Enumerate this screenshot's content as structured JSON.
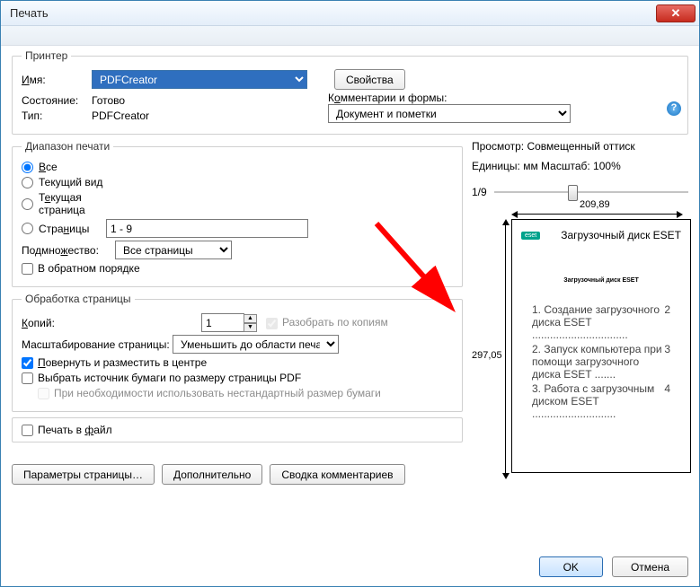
{
  "title": "Печать",
  "printer": {
    "group_label": "Принтер",
    "name_label": "Имя:",
    "name_value": "PDFCreator",
    "properties_btn": "Свойства",
    "status_label": "Состояние:",
    "status_value": "Готово",
    "type_label": "Тип:",
    "type_value": "PDFCreator",
    "comments_label": "Комментарии и формы:",
    "comments_value": "Документ и пометки"
  },
  "range": {
    "group_label": "Диапазон печати",
    "all": "Все",
    "current_view": "Текущий вид",
    "current_page": "Текущая страница",
    "pages": "Страницы",
    "pages_value": "1 - 9",
    "subset_label": "Подмножество:",
    "subset_value": "Все страницы",
    "reverse": "В обратном порядке"
  },
  "handling": {
    "group_label": "Обработка страницы",
    "copies_label": "Копий:",
    "copies_value": "1",
    "collate": "Разобрать по копиям",
    "scaling_label": "Масштабирование страницы:",
    "scaling_value": "Уменьшить до области печати",
    "rotate": "Повернуть и разместить в центре",
    "paper_source": "Выбрать источник бумаги по размеру страницы PDF",
    "custom_paper": "При необходимости использовать нестандартный размер бумаги"
  },
  "print_to_file": "Печать в файл",
  "bottom": {
    "page_setup": "Параметры страницы…",
    "advanced": "Дополнительно",
    "summary": "Сводка комментариев"
  },
  "preview": {
    "header": "Просмотр: Совмещенный оттиск",
    "units": "Единицы: мм Масштаб: 100%",
    "page_of": "1/9",
    "width_mm": "209,89",
    "height_mm": "297,05",
    "doc_title": "Загрузочный диск ESET",
    "logo": "eset"
  },
  "final": {
    "ok": "OK",
    "cancel": "Отмена"
  }
}
